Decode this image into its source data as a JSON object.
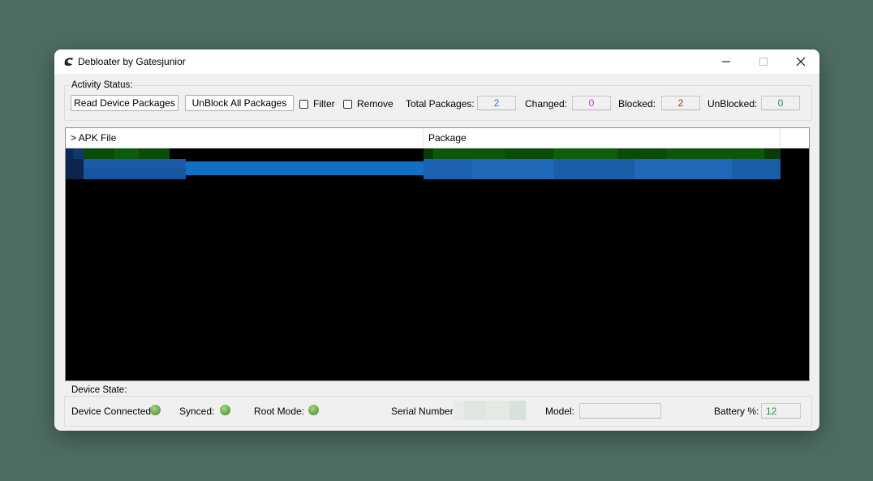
{
  "window": {
    "title": "Debloater by Gatesjunior"
  },
  "activity": {
    "group_label": "Activity Status:",
    "read_button": "Read Device Packages",
    "unblock_button": "UnBlock All Packages",
    "filter_label": "Filter",
    "remove_label": "Remove",
    "total_label": "Total Packages:",
    "total_value": "2",
    "changed_label": "Changed:",
    "changed_value": "0",
    "blocked_label": "Blocked:",
    "blocked_value": "2",
    "unblocked_label": "UnBlocked:",
    "unblocked_value": "0",
    "colors": {
      "total": "#3a6fd8",
      "changed": "#b040c8",
      "blocked": "#d02828",
      "unblocked": "#2a8a4a"
    }
  },
  "list": {
    "columns": [
      "> APK File",
      "Package"
    ],
    "rows": [
      {
        "state": "blocked",
        "highlight": "#0a5a0a"
      },
      {
        "state": "selected",
        "highlight": "#1070c8"
      }
    ]
  },
  "device": {
    "group_label": "Device State:",
    "connected_label": "Device Connected:",
    "synced_label": "Synced:",
    "root_label": "Root Mode:",
    "serial_label": "Serial Number:",
    "model_label": "Model:",
    "model_value": "",
    "battery_label": "Battery %:",
    "battery_value": "12",
    "battery_color": "#2a8a4a"
  }
}
